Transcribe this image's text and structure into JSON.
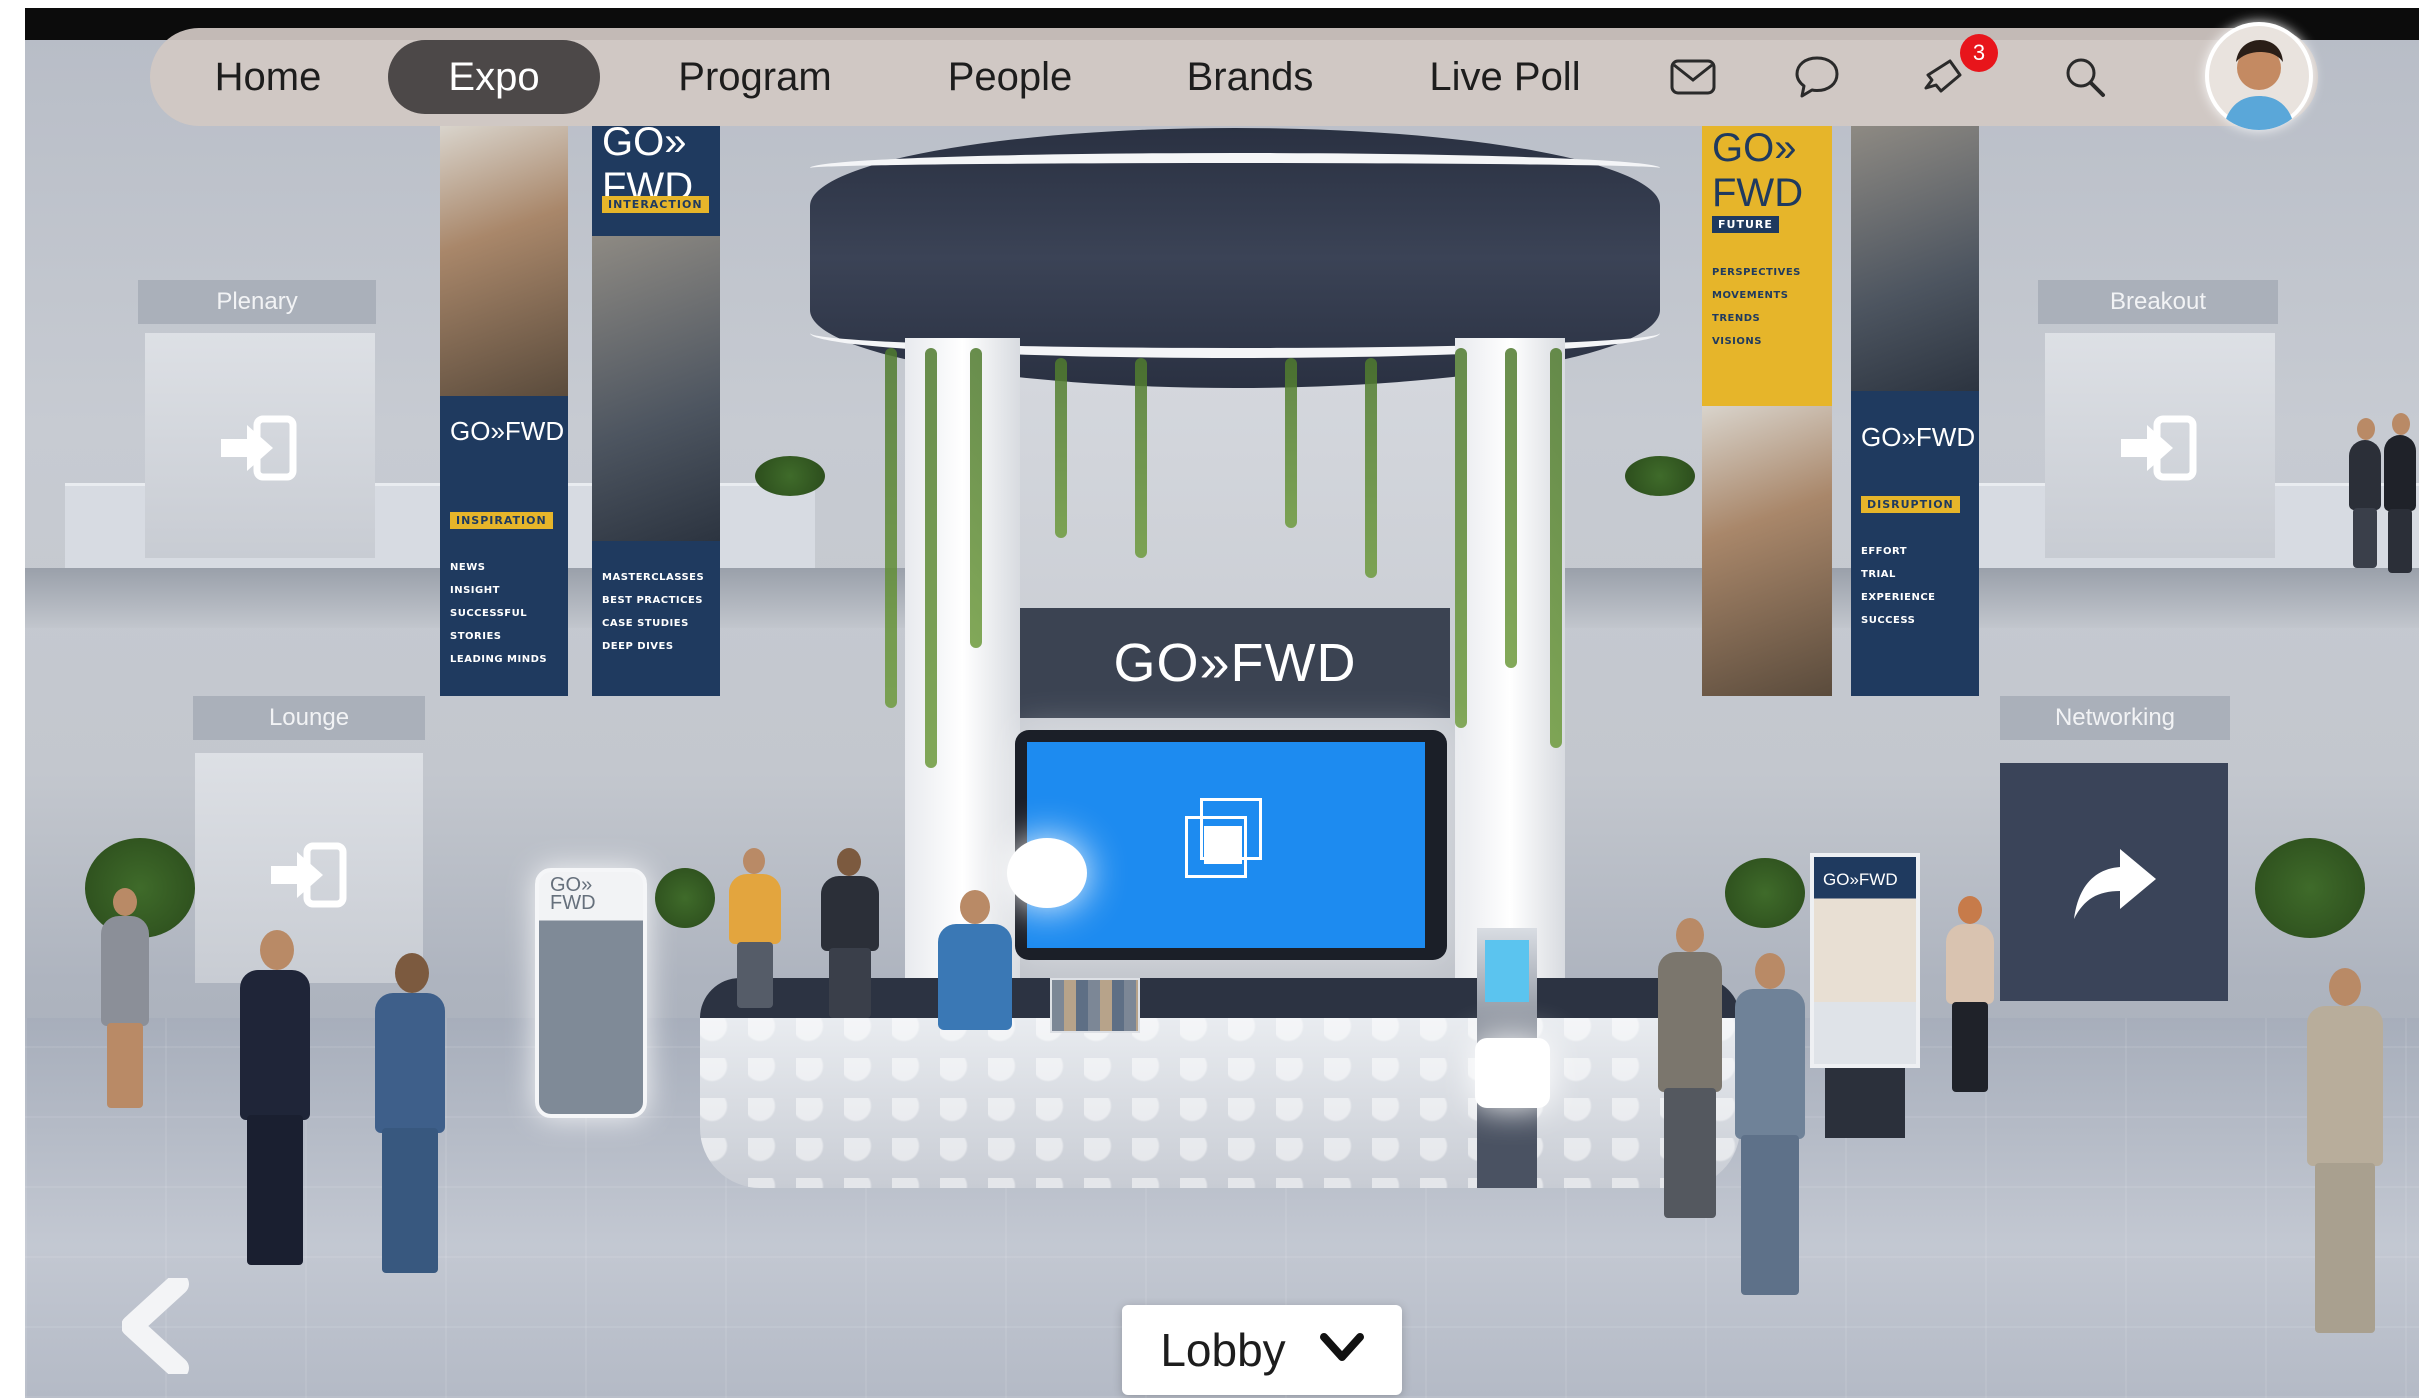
{
  "nav": {
    "items": [
      {
        "label": "Home",
        "active": false
      },
      {
        "label": "Expo",
        "active": true
      },
      {
        "label": "Program",
        "active": false
      },
      {
        "label": "People",
        "active": false
      },
      {
        "label": "Brands",
        "active": false
      },
      {
        "label": "Live Poll",
        "active": false
      }
    ],
    "icons": [
      "mail-icon",
      "chat-icon",
      "notification-icon",
      "search-icon"
    ],
    "notification_count": "3",
    "accent_color": "#4c4848",
    "badge_color": "#e8151b"
  },
  "portals": {
    "plenary": "Plenary",
    "breakout": "Breakout",
    "lounge": "Lounge",
    "networking": "Networking"
  },
  "banners": {
    "b1": {
      "title": "GO»FWD",
      "tag": "INSPIRATION",
      "items": [
        "NEWS",
        "INSIGHT",
        "SUCCESSFUL STORIES",
        "LEADING MINDS"
      ]
    },
    "b2": {
      "title": "GO» FWD",
      "tag": "INTERACTION",
      "items": [
        "MASTERCLASSES",
        "BEST PRACTICES",
        "CASE STUDIES",
        "DEEP DIVES"
      ]
    },
    "b3": {
      "title": "GO» FWD",
      "tag": "FUTURE",
      "items": [
        "PERSPECTIVES",
        "MOVEMENTS",
        "TRENDS",
        "VISIONS"
      ]
    },
    "b4": {
      "title": "GO»FWD",
      "tag": "DISRUPTION",
      "items": [
        "EFFORT",
        "TRIAL",
        "EXPERIENCE",
        "SUCCESS"
      ]
    }
  },
  "booth": {
    "header": "GO»FWD",
    "screen_color": "#1d8bf0"
  },
  "stands": {
    "left_title": "GO» FWD",
    "right_title": "GO»FWD"
  },
  "location": {
    "current": "Lobby"
  }
}
